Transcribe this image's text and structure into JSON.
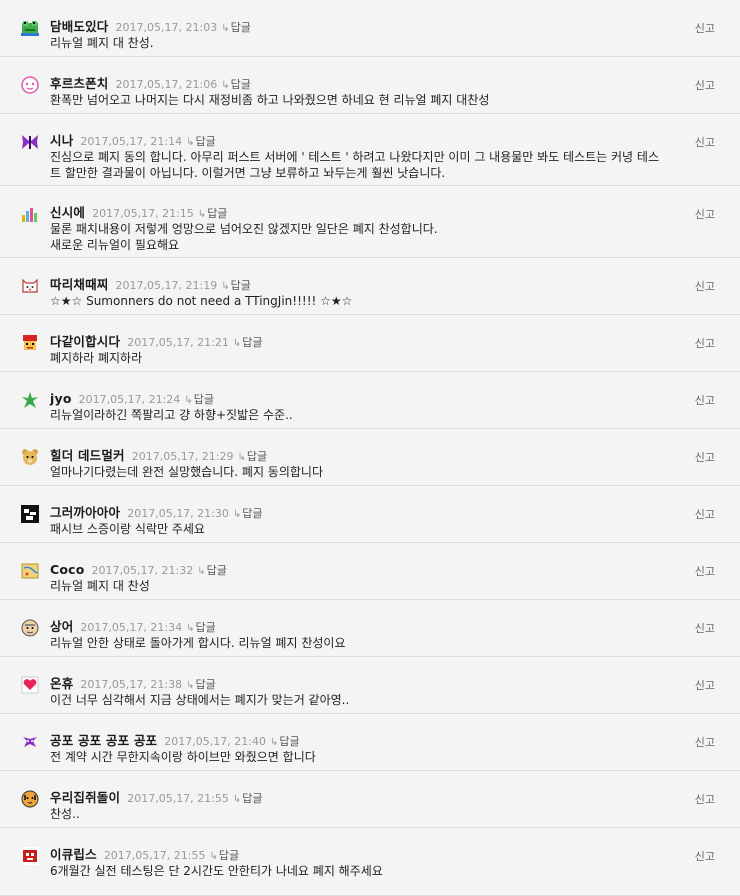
{
  "comments": [
    {
      "name": "담배도있다",
      "date": "2017,05,17, 21:03",
      "reply": "답글",
      "report": "신고",
      "text": "리뉴얼 폐지 대 찬성.",
      "icon": "green-frog-icon"
    },
    {
      "name": "후르츠폰치",
      "date": "2017,05,17, 21:06",
      "reply": "답글",
      "report": "신고",
      "text": "환폭만 넘어오고 나머지는 다시 재정비좀 하고 나와줬으면 하네요 현 리뉴얼 폐지 대찬성",
      "icon": "pink-face-icon"
    },
    {
      "name": "시나",
      "date": "2017,05,17, 21:14",
      "reply": "답글",
      "report": "신고",
      "text": "진심으로 폐지 동의 합니다. 아무리 퍼스트 서버에 ' 테스트 ' 하려고 나왔다지만 이미 그 내용물만 봐도 테스트는 커녕 테스\n트 할만한 결과물이 아닙니다. 이럴거면 그냥 보류하고 놔두는게 훨씬 낫습니다.",
      "icon": "purple-butterfly-icon"
    },
    {
      "name": "신시에",
      "date": "2017,05,17, 21:15",
      "reply": "답글",
      "report": "신고",
      "text": "물론 패치내용이 저렇게 엉망으로 넘어오진 않겠지만 일단은 폐지 찬성합니다.\n새로운 리뉴얼이 필요해요",
      "icon": "colorful-bars-icon"
    },
    {
      "name": "따리채때찌",
      "date": "2017,05,17, 21:19",
      "reply": "답글",
      "report": "신고",
      "text": "☆★☆ Sumonners do not need a TTingJin!!!!! ☆★☆",
      "icon": "cat-face-icon"
    },
    {
      "name": "다같이합시다",
      "date": "2017,05,17, 21:21",
      "reply": "답글",
      "report": "신고",
      "text": "폐지하라 폐지하라",
      "icon": "red-hat-character-icon"
    },
    {
      "name": "jyo",
      "date": "2017,05,17, 21:24",
      "reply": "답글",
      "report": "신고",
      "text": "리뉴얼이라하긴 쪽팔리고 걍 하향+짓밟은 수준..",
      "icon": "green-leaf-icon"
    },
    {
      "name": "힐더 데드멀커",
      "date": "2017,05,17, 21:29",
      "reply": "답글",
      "report": "신고",
      "text": "얼마나기다렸는데 완전 실망했습니다. 폐지 동의합니다",
      "icon": "bear-face-icon"
    },
    {
      "name": "그러까아아아",
      "date": "2017,05,17, 21:30",
      "reply": "답글",
      "report": "신고",
      "text": "패시브 스증이랑 식락만 주세요",
      "icon": "black-white-pixel-icon"
    },
    {
      "name": "Coco",
      "date": "2017,05,17, 21:32",
      "reply": "답글",
      "report": "신고",
      "text": "리뉴얼 폐지 대 찬성",
      "icon": "yellow-map-icon"
    },
    {
      "name": "상어",
      "date": "2017,05,17, 21:34",
      "reply": "답글",
      "report": "신고",
      "text": "리뉴얼 안한 상태로 돌아가게 합시다. 리뉴얼 폐지 찬성이요",
      "icon": "old-man-face-icon"
    },
    {
      "name": "온휴",
      "date": "2017,05,17, 21:38",
      "reply": "답글",
      "report": "신고",
      "text": "이건 너무 심각해서 지금 상태에서는 폐지가 맞는거 같아영..",
      "icon": "heart-card-icon"
    },
    {
      "name": "공포 공포 공포 공포",
      "date": "2017,05,17, 21:40",
      "reply": "답글",
      "report": "신고",
      "text": "전 계약 시간 무한지속이랑 하이브만 와줬으면 합니다",
      "icon": "purple-creature-icon"
    },
    {
      "name": "우리집쥐돌이",
      "date": "2017,05,17, 21:55",
      "reply": "답글",
      "report": "신고",
      "text": "찬성..",
      "icon": "tiger-face-icon"
    },
    {
      "name": "이큐립스",
      "date": "2017,05,17, 21:55",
      "reply": "답글",
      "report": "신고",
      "text": "6개월간 실전 테스팅은 단 2시간도 안한티가 나네요 폐지 해주세요",
      "icon": "red-figure-icon"
    }
  ]
}
